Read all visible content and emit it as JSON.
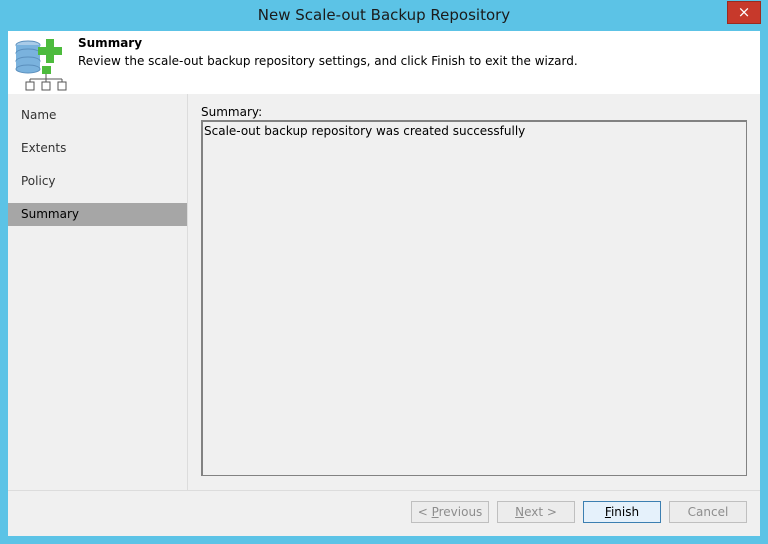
{
  "window": {
    "title": "New Scale-out Backup Repository",
    "close_glyph": "×"
  },
  "header": {
    "icon": "scale-out-repository-add-icon",
    "title": "Summary",
    "description": "Review the scale-out backup repository settings, and click Finish to exit the wizard."
  },
  "sidebar": {
    "items": [
      {
        "label": "Name",
        "active": false
      },
      {
        "label": "Extents",
        "active": false
      },
      {
        "label": "Policy",
        "active": false
      },
      {
        "label": "Summary",
        "active": true
      }
    ]
  },
  "main": {
    "summary_label": "Summary:",
    "summary_text": "Scale-out backup repository was created successfully"
  },
  "buttons": {
    "previous": {
      "prefix": "< ",
      "mnemonic": "P",
      "rest": "revious",
      "enabled": false
    },
    "next": {
      "mnemonic": "N",
      "rest": "ext >",
      "enabled": false
    },
    "finish": {
      "mnemonic": "F",
      "rest": "inish",
      "enabled": true
    },
    "cancel": {
      "label": "Cancel",
      "enabled": false
    }
  },
  "colors": {
    "titlebar": "#5cc3e6",
    "close": "#c7392b",
    "active_nav": "#a6a6a6",
    "icon_green": "#4dbb3d",
    "icon_blue": "#7ab2dd"
  }
}
